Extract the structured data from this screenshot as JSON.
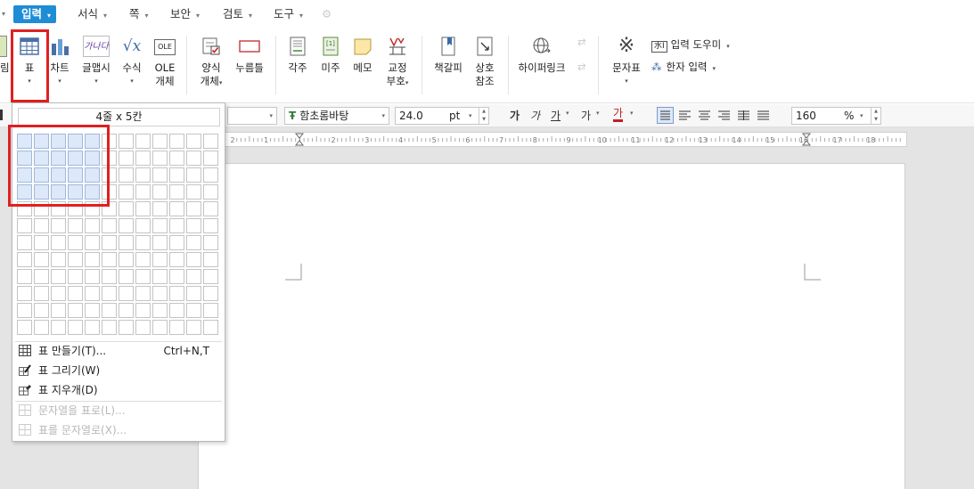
{
  "menu": [
    {
      "label": "입력",
      "active": true
    },
    {
      "label": "서식"
    },
    {
      "label": "쪽"
    },
    {
      "label": "보안"
    },
    {
      "label": "검토"
    },
    {
      "label": "도구"
    }
  ],
  "ribbon": {
    "partial_label": "림",
    "table_label": "표",
    "chart_label": "차트",
    "glyph_label": "글맵시",
    "equation_label": "수식",
    "ole_label1": "OLE",
    "ole_label2": "개체",
    "form_label1": "양식",
    "form_label2": "개체",
    "button_label": "누름틀",
    "footnote_label": "각주",
    "endnote_label": "미주",
    "memo_label": "메모",
    "proof_label1": "교정",
    "proof_label2": "부호",
    "bookmark_label": "책갈피",
    "crossref_label1": "상호",
    "crossref_label2": "참조",
    "hyperlink_label": "하이퍼링크",
    "charmap_label": "문자표",
    "input_helper_label": "입력 도우미",
    "hanja_label": "한자 입력",
    "ole_icon_text": "OLE",
    "glyph_icon_text": "가나다",
    "input_helper_tag": "水I"
  },
  "format": {
    "font": "함초롬바탕",
    "size": "24.0",
    "unit": "pt",
    "bold": "가",
    "italic": "가",
    "underline": "가",
    "strike": "가",
    "color": "가",
    "zoom": "160",
    "zoom_unit": "%"
  },
  "ruler": {
    "numbers": [
      "2",
      "1",
      "1",
      "2",
      "3",
      "4",
      "5",
      "6",
      "7",
      "8",
      "9",
      "10",
      "11",
      "12",
      "13",
      "14",
      "15",
      "16",
      "17",
      "18"
    ]
  },
  "table_panel": {
    "title": "4줄 x 5칸",
    "rows": 12,
    "cols": 12,
    "selected_rows": 4,
    "selected_cols": 5,
    "items": [
      {
        "label": "표 만들기(T)...",
        "shortcut": "Ctrl+N,T",
        "enabled": true
      },
      {
        "label": "표 그리기(W)",
        "shortcut": "",
        "enabled": true
      },
      {
        "label": "표 지우개(D)",
        "shortcut": "",
        "enabled": true
      },
      {
        "label": "문자열을 표로(L)...",
        "shortcut": "",
        "enabled": false
      },
      {
        "label": "표를 문자열로(X)...",
        "shortcut": "",
        "enabled": false
      }
    ]
  },
  "colors": {
    "accent": "#1f8dd6",
    "highlight": "#e02020",
    "selected_cell": "#dde8f8"
  }
}
